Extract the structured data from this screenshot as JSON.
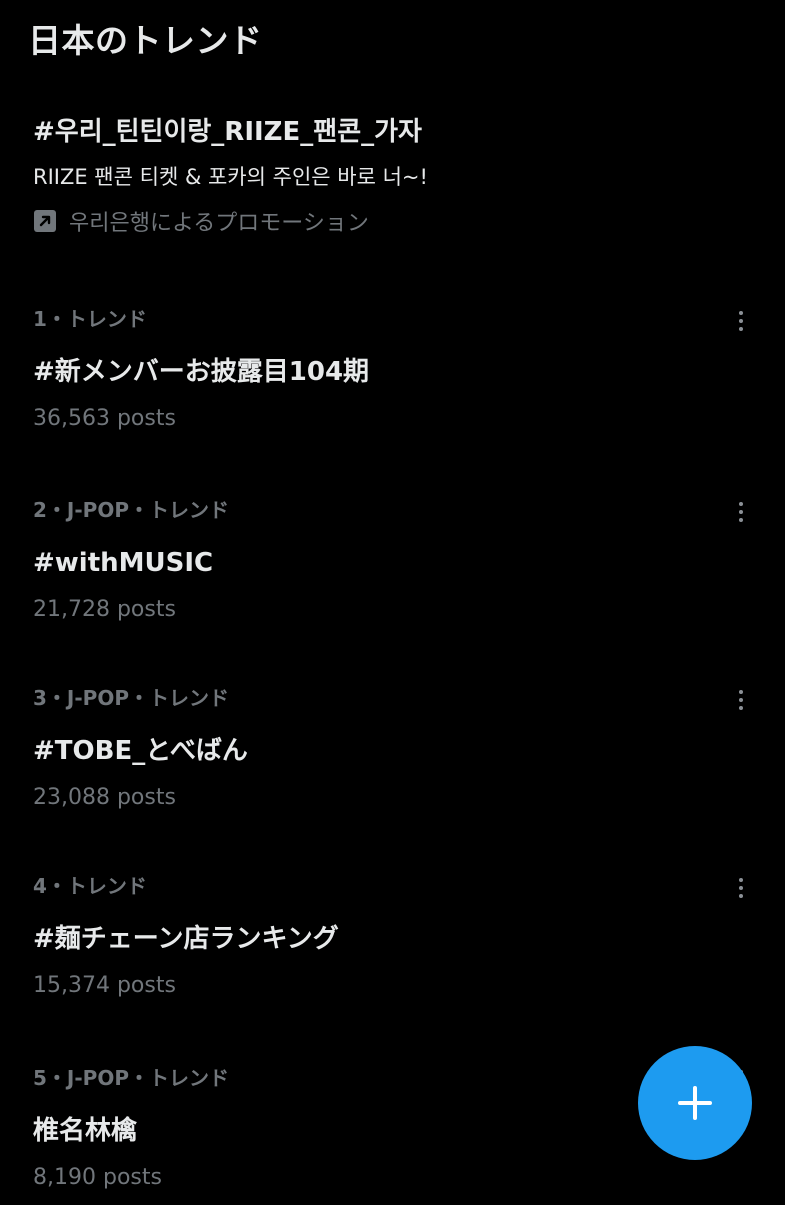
{
  "header": {
    "title": "日本のトレンド"
  },
  "promo": {
    "title": "#우리_틴틴이랑_RIIZE_팬콘_가자",
    "description": "RIIZE 팬콘 티켓 & 포카의 주인은 바로 너~!",
    "promoted_by": "우리은행によるプロモーション",
    "icon": "promoted-arrow-icon"
  },
  "trends": [
    {
      "meta": "1・トレンド",
      "name": "#新メンバーお披露目104期",
      "count": "36,563 posts"
    },
    {
      "meta": "2・J-POP・トレンド",
      "name": "#withMUSIC",
      "count": "21,728 posts"
    },
    {
      "meta": "3・J-POP・トレンド",
      "name": "#TOBE_とべばん",
      "count": "23,088 posts"
    },
    {
      "meta": "4・トレンド",
      "name": "#麺チェーン店ランキング",
      "count": "15,374 posts"
    },
    {
      "meta": "5・J-POP・トレンド",
      "name": "椎名林檎",
      "count": "8,190 posts"
    }
  ],
  "fab": {
    "icon": "plus-icon"
  },
  "colors": {
    "background": "#000000",
    "primary_text": "#e7e9ea",
    "secondary_text": "#71767b",
    "accent": "#1d9bf0"
  }
}
